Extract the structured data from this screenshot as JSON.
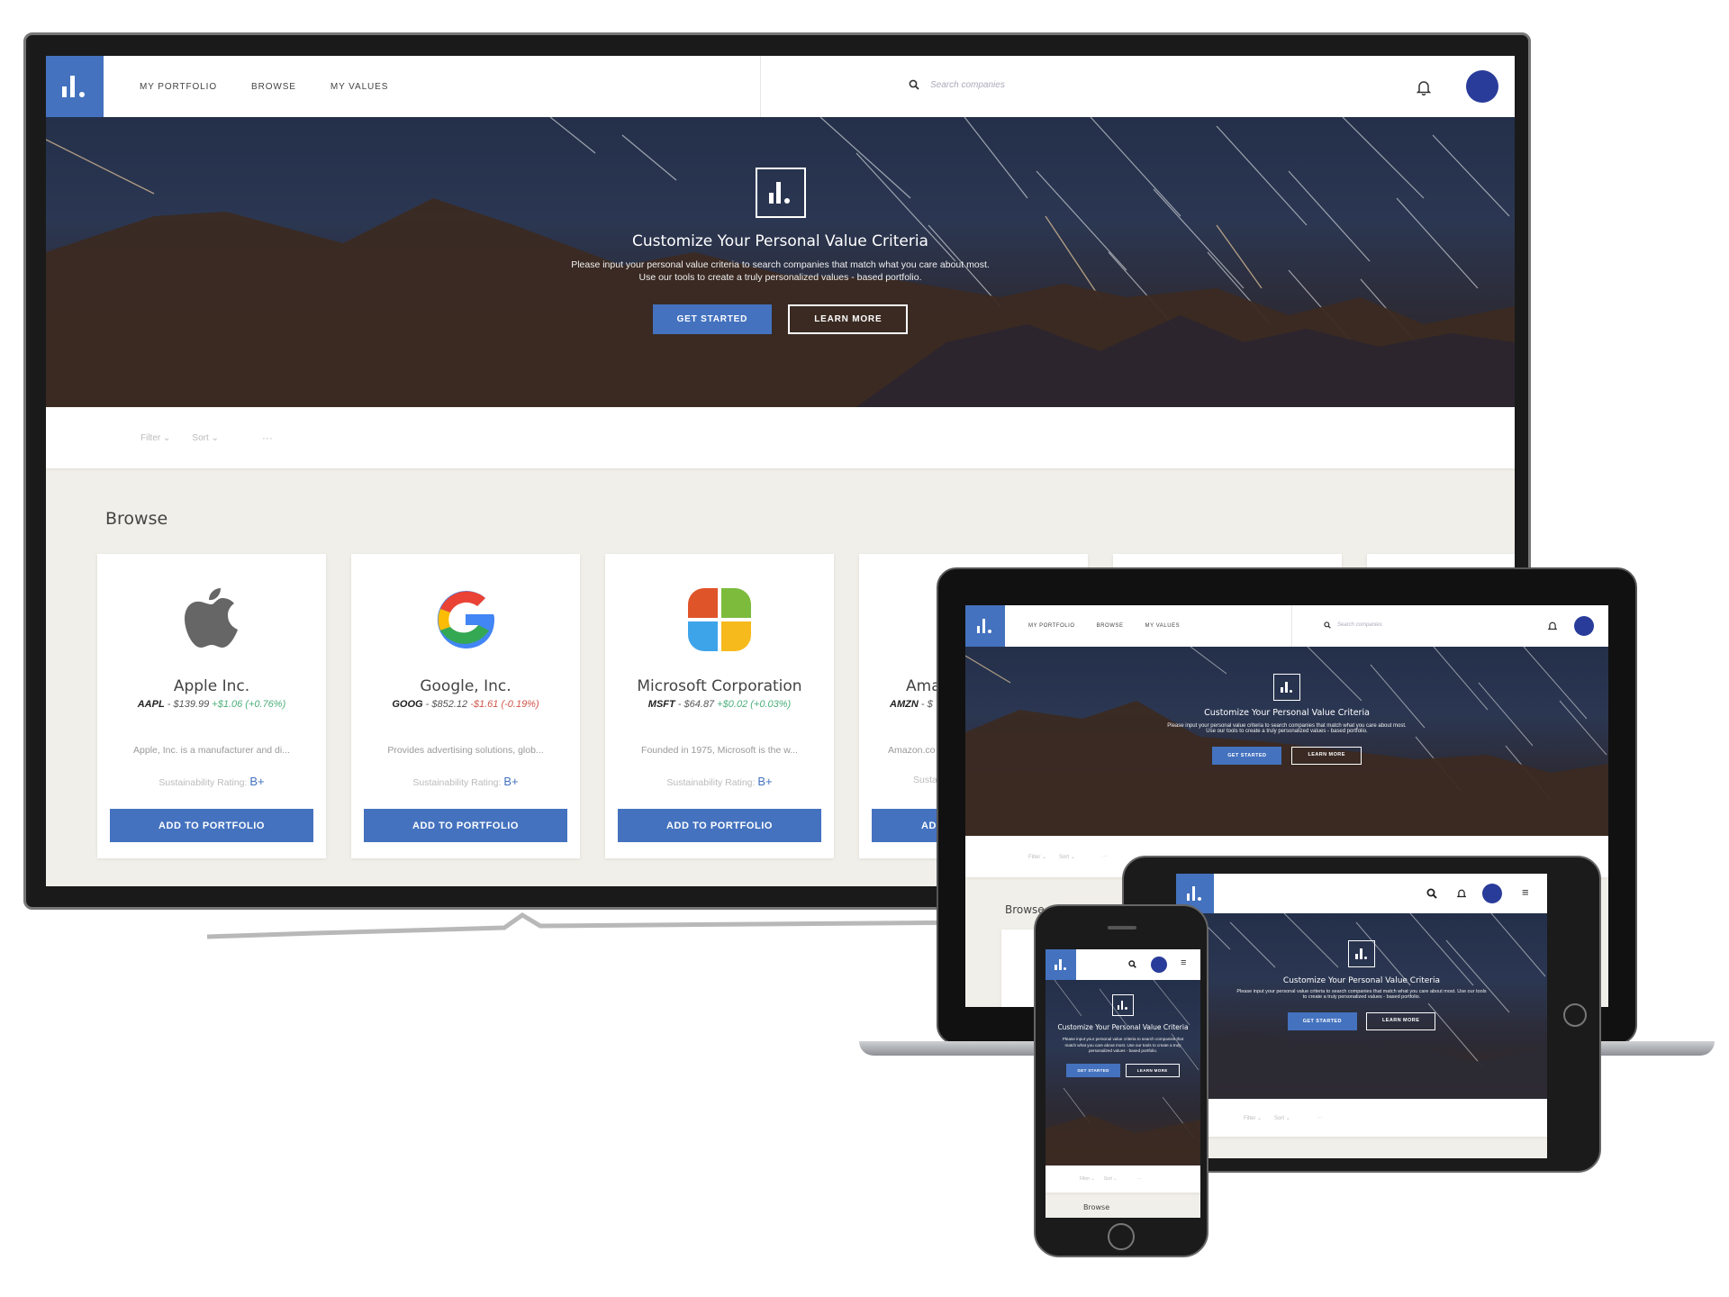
{
  "brand": {
    "accent": "#4472bf",
    "avatar_color": "#2a3c9a"
  },
  "nav": {
    "links": [
      "MY PORTFOLIO",
      "BROWSE",
      "MY VALUES"
    ],
    "search_placeholder": "Search companies"
  },
  "hero": {
    "title": "Customize Your Personal Value Criteria",
    "subtitle_line1": "Please input your personal value criteria to search companies that match what you care about most.",
    "subtitle_line2": "Use our tools to create a truly personalized values - based portfolio.",
    "subtitle_full": "Please input your personal value criteria to search companies that match what you care about most. Use our tools to create a truly personalized values - based portfolio.",
    "phone_title": "Customize Your Personal Value Criteria",
    "primary_button": "GET STARTED",
    "secondary_button": "LEARN MORE"
  },
  "toolbar": {
    "filter": "Filter",
    "sort": "Sort",
    "more": "···"
  },
  "browse": {
    "title": "Browse",
    "cards": [
      {
        "name": "Apple Inc.",
        "ticker": "AAPL",
        "price": "$139.99",
        "change": "+$1.06 (+0.76%)",
        "direction": "up",
        "desc": "Apple, Inc. is a manufacturer and di...",
        "rating_label": "Sustainability Rating:",
        "rating": "B+",
        "button": "ADD TO PORTFOLIO",
        "logo": "apple-logo"
      },
      {
        "name": "Google, Inc.",
        "ticker": "GOOG",
        "price": "$852.12",
        "change": "-$1.61 (-0.19%)",
        "direction": "down",
        "desc": "Provides advertising solutions, glob...",
        "rating_label": "Sustainability Rating:",
        "rating": "B+",
        "button": "ADD TO PORTFOLIO",
        "logo": "google-logo"
      },
      {
        "name": "Microsoft Corporation",
        "ticker": "MSFT",
        "price": "$64.87",
        "change": "+$0.02 (+0.03%)",
        "direction": "up",
        "desc": "Founded in 1975, Microsoft is the w...",
        "rating_label": "Sustainability Rating:",
        "rating": "B+",
        "button": "ADD TO PORTFOLIO",
        "logo": "microsoft-logo"
      },
      {
        "name": "Ama",
        "ticker": "AMZN",
        "price": "$",
        "change": "",
        "direction": "up",
        "desc": "Amazon.co",
        "rating_label": "Susta",
        "rating": "",
        "button": "ADD",
        "logo": ""
      }
    ]
  }
}
